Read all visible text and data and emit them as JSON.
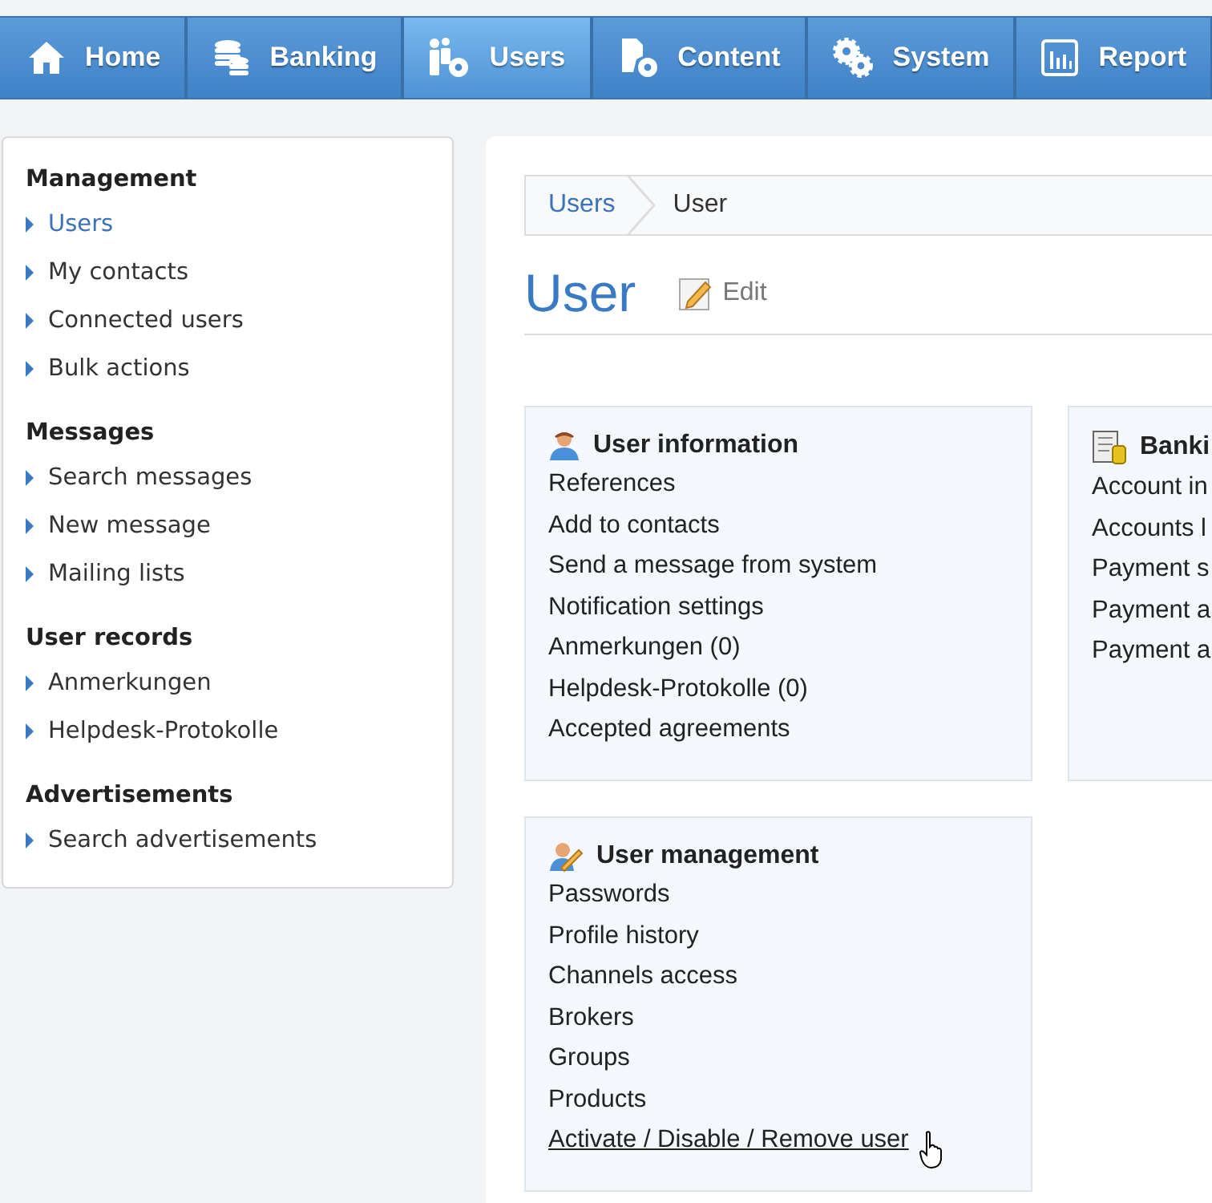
{
  "nav_tabs": [
    {
      "label": "Home",
      "kind": "home",
      "selected": false
    },
    {
      "label": "Banking",
      "kind": "coins",
      "selected": false
    },
    {
      "label": "Users",
      "kind": "users",
      "selected": true
    },
    {
      "label": "Content",
      "kind": "content",
      "selected": false
    },
    {
      "label": "System",
      "kind": "system",
      "selected": false
    },
    {
      "label": "Report",
      "kind": "reports",
      "selected": false
    }
  ],
  "sidebar": {
    "sections": [
      {
        "title": "Management",
        "items": [
          {
            "label": "Users",
            "selected": true
          },
          {
            "label": "My contacts",
            "selected": false
          },
          {
            "label": "Connected users",
            "selected": false
          },
          {
            "label": "Bulk actions",
            "selected": false
          }
        ]
      },
      {
        "title": "Messages",
        "items": [
          {
            "label": "Search messages",
            "selected": false
          },
          {
            "label": "New message",
            "selected": false
          },
          {
            "label": "Mailing lists",
            "selected": false
          }
        ]
      },
      {
        "title": "User records",
        "items": [
          {
            "label": "Anmerkungen",
            "selected": false
          },
          {
            "label": "Helpdesk-Protokolle",
            "selected": false
          }
        ]
      },
      {
        "title": "Advertisements",
        "items": [
          {
            "label": "Search advertisements",
            "selected": false
          }
        ]
      }
    ]
  },
  "breadcrumb": [
    "Users",
    "User"
  ],
  "page_title": "User",
  "edit_link": "Edit",
  "cards": [
    {
      "title": "User information",
      "kind": "user",
      "items": [
        {
          "label": "References",
          "hovered": false
        },
        {
          "label": "Add to contacts",
          "hovered": false
        },
        {
          "label": "Send a message from system",
          "hovered": false
        },
        {
          "label": "Notification settings",
          "hovered": false
        },
        {
          "label": "Anmerkungen (0)",
          "hovered": false
        },
        {
          "label": "Helpdesk-Protokolle (0)",
          "hovered": false
        },
        {
          "label": "Accepted agreements",
          "hovered": false
        }
      ]
    },
    {
      "title": "Banki",
      "kind": "ledger",
      "items": [
        {
          "label": "Account in",
          "hovered": false
        },
        {
          "label": "Accounts l",
          "hovered": false
        },
        {
          "label": "Payment s",
          "hovered": false
        },
        {
          "label": "Payment a",
          "hovered": false
        },
        {
          "label": "Payment a",
          "hovered": false
        }
      ]
    },
    {
      "title": "User management",
      "kind": "user-edit",
      "items": [
        {
          "label": "Passwords",
          "hovered": false
        },
        {
          "label": "Profile history",
          "hovered": false
        },
        {
          "label": "Channels access",
          "hovered": false
        },
        {
          "label": "Brokers",
          "hovered": false
        },
        {
          "label": "Groups",
          "hovered": false
        },
        {
          "label": "Products",
          "hovered": false
        },
        {
          "label": "Activate / Disable / Remove user",
          "hovered": true
        }
      ]
    }
  ]
}
